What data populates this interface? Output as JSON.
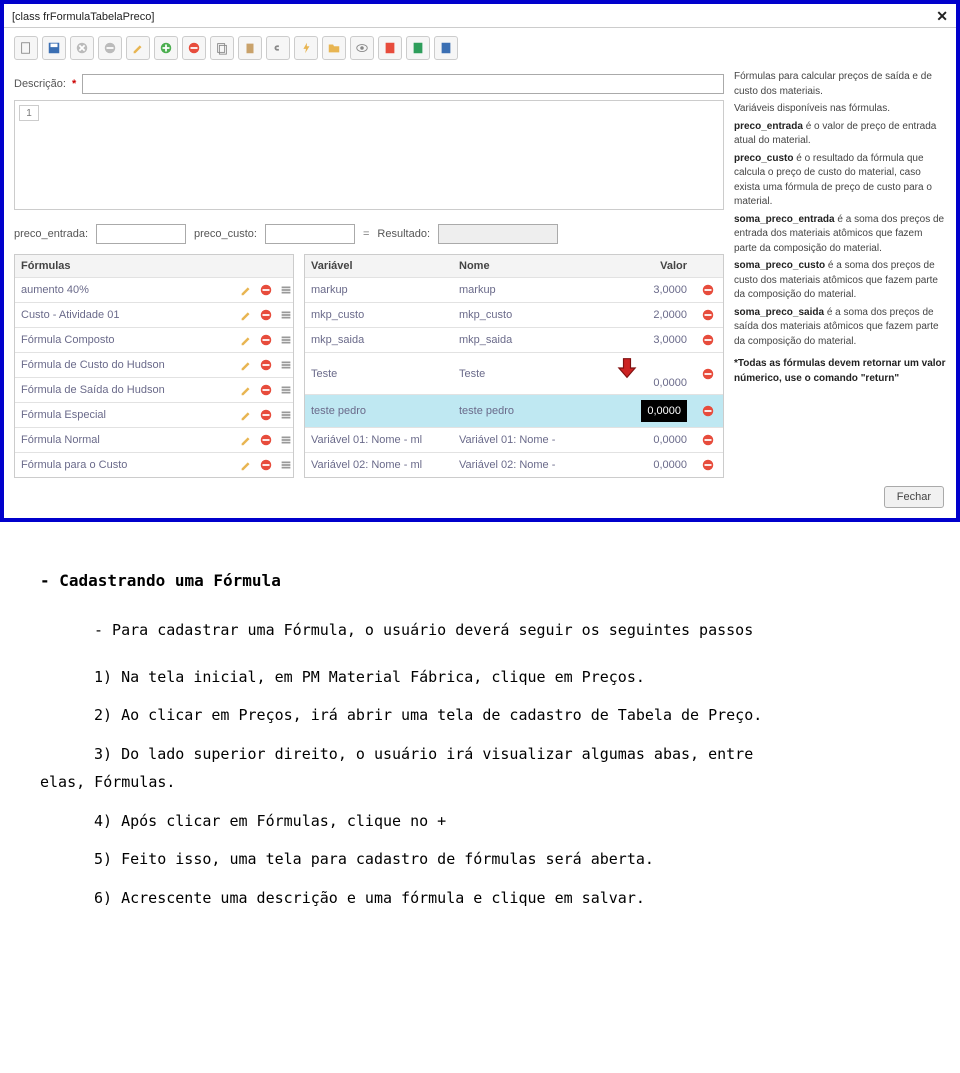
{
  "titlebar": {
    "title": "[class frFormulaTabelaPreco]"
  },
  "toolbar_icons": [
    "new",
    "save",
    "cancel",
    "undo",
    "edit",
    "add",
    "remove",
    "copy",
    "paste",
    "link",
    "flash",
    "folder",
    "view",
    "pdf",
    "excel",
    "word"
  ],
  "desc": {
    "label": "Descrição:",
    "asterisk": "*",
    "value": ""
  },
  "formula_line": "1",
  "vars_row": {
    "preco_entrada_label": "preco_entrada:",
    "preco_custo_label": "preco_custo:",
    "equals": "=",
    "resultado_label": "Resultado:"
  },
  "left_header": "Fórmulas",
  "formulas": [
    "aumento 40%",
    "Custo - Atividade 01",
    "Fórmula Composto",
    "Fórmula de Custo do Hudson",
    "Fórmula de Saída do Hudson",
    "Fórmula Especial",
    "Fórmula Normal",
    "Fórmula para o Custo"
  ],
  "right_header": {
    "c1": "Variável",
    "c2": "Nome",
    "c3": "Valor"
  },
  "variables": [
    {
      "var": "markup",
      "nome": "markup",
      "valor": "3,0000",
      "selected": false
    },
    {
      "var": "mkp_custo",
      "nome": "mkp_custo",
      "valor": "2,0000",
      "selected": false
    },
    {
      "var": "mkp_saida",
      "nome": "mkp_saida",
      "valor": "3,0000",
      "selected": false
    },
    {
      "var": "Teste",
      "nome": "Teste",
      "valor": "0,0000",
      "selected": false,
      "arrow": true
    },
    {
      "var": "teste pedro",
      "nome": "teste pedro",
      "valor": "0,0000",
      "selected": true
    },
    {
      "var": "Variável 01: Nome - ml",
      "nome": "Variável 01: Nome -",
      "valor": "0,0000",
      "selected": false
    },
    {
      "var": "Variável 02: Nome - ml",
      "nome": "Variável 02: Nome -",
      "valor": "0,0000",
      "selected": false
    }
  ],
  "help": {
    "p1": "Fórmulas para calcular preços de saída e de custo dos materiais.",
    "p2": "Variáveis disponíveis nas fórmulas.",
    "b1": "preco_entrada",
    "t1": " é o valor de preço de entrada atual do material.",
    "b2": "preco_custo",
    "t2": " é o resultado da fórmula que calcula o preço de custo do material, caso exista uma fórmula de preço de custo para o material.",
    "b3": "soma_preco_entrada",
    "t3": " é a soma dos preços de entrada dos materiais atômicos que fazem parte da composição do material.",
    "b4": "soma_preco_custo",
    "t4": " é a soma dos preços de custo dos materiais atômicos que fazem parte da composição do material.",
    "b5": "soma_preco_saida",
    "t5": " é a soma dos preços de saída dos materiais atômicos que fazem parte da composição do material.",
    "note": "*Todas as fórmulas devem retornar um valor númerico, use o comando \"return\""
  },
  "footer": {
    "fechar": "Fechar"
  },
  "instructions": {
    "heading": "- Cadastrando uma Fórmula",
    "lead": "- Para cadastrar uma Fórmula, o usuário deverá seguir os seguintes passos",
    "s1": "1) Na tela inicial, em PM Material Fábrica, clique em Preços.",
    "s2": "2) Ao clicar em Preços, irá abrir uma tela de cadastro de Tabela de Preço.",
    "s3a": "3) Do lado superior direito, o usuário irá visualizar algumas abas, entre",
    "s3b": "elas, Fórmulas.",
    "s4": "4) Após clicar em Fórmulas, clique no +",
    "s5": "5) Feito isso, uma tela para cadastro de fórmulas será aberta.",
    "s6": "6) Acrescente uma descrição e uma fórmula e clique em salvar."
  }
}
